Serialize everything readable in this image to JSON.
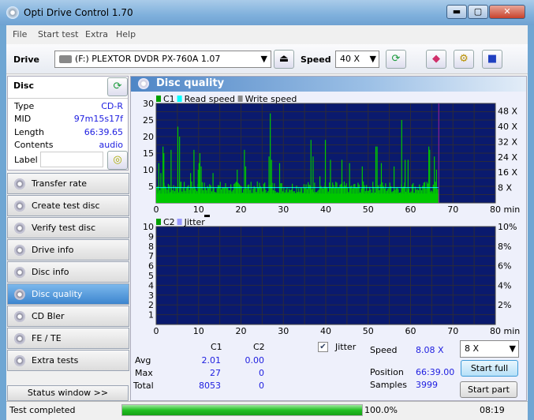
{
  "window": {
    "title": "Opti Drive Control 1.70",
    "minimize": "▬",
    "maximize": "▢",
    "close": "✕"
  },
  "menu": [
    "File",
    "Start test",
    "Extra",
    "Help"
  ],
  "toolbar": {
    "drive_label": "Drive",
    "drive_value": "(F:)  PLEXTOR DVDR   PX-760A 1.07",
    "speed_label": "Speed",
    "speed_value": "40 X"
  },
  "disc": {
    "header": "Disc",
    "rows": [
      {
        "k": "Type",
        "v": "CD-R"
      },
      {
        "k": "MID",
        "v": "97m15s17f"
      },
      {
        "k": "Length",
        "v": "66:39.65"
      },
      {
        "k": "Contents",
        "v": "audio"
      }
    ],
    "label_label": "Label",
    "label_value": ""
  },
  "nav": [
    {
      "label": "Transfer rate"
    },
    {
      "label": "Create test disc"
    },
    {
      "label": "Verify test disc"
    },
    {
      "label": "Drive info"
    },
    {
      "label": "Disc info"
    },
    {
      "label": "Disc quality",
      "active": true
    },
    {
      "label": "CD Bler"
    },
    {
      "label": "FE / TE"
    },
    {
      "label": "Extra tests"
    }
  ],
  "status_window_btn": "Status window >>",
  "panel_title": "Disc quality",
  "chart_data": [
    {
      "type": "bar",
      "legend": [
        "C1",
        "Read speed",
        "Write speed"
      ],
      "legend_colors": [
        "#00a000",
        "#00ffff",
        "#888888"
      ],
      "x_ticks": [
        "0",
        "10",
        "20",
        "30",
        "40",
        "50",
        "60",
        "70",
        "80 min"
      ],
      "xlim": [
        0,
        80
      ],
      "y_ticks": [
        "5",
        "10",
        "15",
        "20",
        "25",
        "30"
      ],
      "ylim": [
        0,
        30
      ],
      "y2_ticks": [
        "8 X",
        "16 X",
        "24 X",
        "32 X",
        "40 X",
        "48 X"
      ],
      "y2lim": [
        0,
        52
      ],
      "c1_baseline_approx": 4,
      "c1_spikes": [
        [
          0.5,
          12
        ],
        [
          1,
          9
        ],
        [
          1.5,
          17
        ],
        [
          1.7,
          15
        ],
        [
          3.4,
          16
        ],
        [
          5,
          23
        ],
        [
          5.4,
          20
        ],
        [
          8,
          9
        ],
        [
          8.8,
          16
        ],
        [
          9.8,
          10
        ],
        [
          10,
          12
        ],
        [
          10.2,
          15
        ],
        [
          10.5,
          11
        ],
        [
          13.3,
          9
        ],
        [
          19,
          10
        ],
        [
          20.7,
          16
        ],
        [
          21,
          11
        ],
        [
          26.5,
          14
        ],
        [
          26.8,
          27
        ],
        [
          27.1,
          13
        ],
        [
          29,
          12
        ],
        [
          36.4,
          19
        ],
        [
          36.9,
          14
        ],
        [
          38.5,
          8
        ],
        [
          39.8,
          19
        ],
        [
          41,
          13
        ],
        [
          43.7,
          13
        ],
        [
          45.5,
          12
        ],
        [
          48.5,
          11
        ],
        [
          51.7,
          17
        ],
        [
          52,
          17
        ],
        [
          53,
          12
        ],
        [
          56,
          11
        ],
        [
          57.8,
          25
        ],
        [
          58.6,
          13
        ],
        [
          59.3,
          13
        ],
        [
          64.2,
          17
        ],
        [
          64.4,
          16
        ],
        [
          65.5,
          14
        ],
        [
          66,
          10
        ]
      ],
      "read_speed_x": 8,
      "data_end_min": 66.65,
      "grid": true,
      "plot_bg": "#0a1a6e"
    },
    {
      "type": "bar",
      "legend": [
        "C2",
        "Jitter"
      ],
      "legend_colors": [
        "#00a000",
        "#9999ff"
      ],
      "x_ticks": [
        "0",
        "10",
        "20",
        "30",
        "40",
        "50",
        "60",
        "70",
        "80 min"
      ],
      "xlim": [
        0,
        80
      ],
      "y_ticks": [
        "1",
        "2",
        "3",
        "4",
        "5",
        "6",
        "7",
        "8",
        "9",
        "10"
      ],
      "ylim": [
        0,
        10
      ],
      "y2_ticks": [
        "2%",
        "4%",
        "6%",
        "8%",
        "10%"
      ],
      "y2lim": [
        0,
        10
      ],
      "c2_values": [],
      "grid": true
    }
  ],
  "stats": {
    "col_c1": "C1",
    "col_c2": "C2",
    "rows": [
      {
        "k": "Avg",
        "c1": "2.01",
        "c2": "0.00"
      },
      {
        "k": "Max",
        "c1": "27",
        "c2": "0"
      },
      {
        "k": "Total",
        "c1": "8053",
        "c2": "0"
      }
    ],
    "jitter_label": "Jitter",
    "jitter_checked": true,
    "speed_label": "Speed",
    "speed_value": "8.08 X",
    "position_label": "Position",
    "position_value": "66:39.00",
    "samples_label": "Samples",
    "samples_value": "3999",
    "speed_select": "8 X",
    "start_full": "Start full",
    "start_part": "Start part"
  },
  "statusbar": {
    "text": "Test completed",
    "progress": 100,
    "progress_text": "100.0%",
    "time": "08:19"
  }
}
